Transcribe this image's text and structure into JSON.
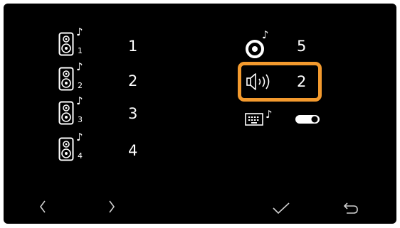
{
  "zone_speakers": [
    {
      "zone": "1",
      "value": "1"
    },
    {
      "zone": "2",
      "value": "2"
    },
    {
      "zone": "3",
      "value": "3"
    },
    {
      "zone": "4",
      "value": "4"
    }
  ],
  "settings": {
    "ringtone_value": "5",
    "volume_value": "2",
    "keypad_tone_toggle": "on"
  },
  "icons": {
    "music_note": "♪",
    "speaker": "speaker-icon",
    "disc": "disc-icon",
    "volume": "volume-icon",
    "keypad": "keypad-icon",
    "toggle": "toggle-icon",
    "prev": "chevron-left-icon",
    "next": "chevron-right-icon",
    "confirm": "checkmark-icon",
    "back": "return-icon"
  },
  "colors": {
    "background": "#000000",
    "foreground": "#ffffff",
    "highlight": "#f39a2e"
  }
}
